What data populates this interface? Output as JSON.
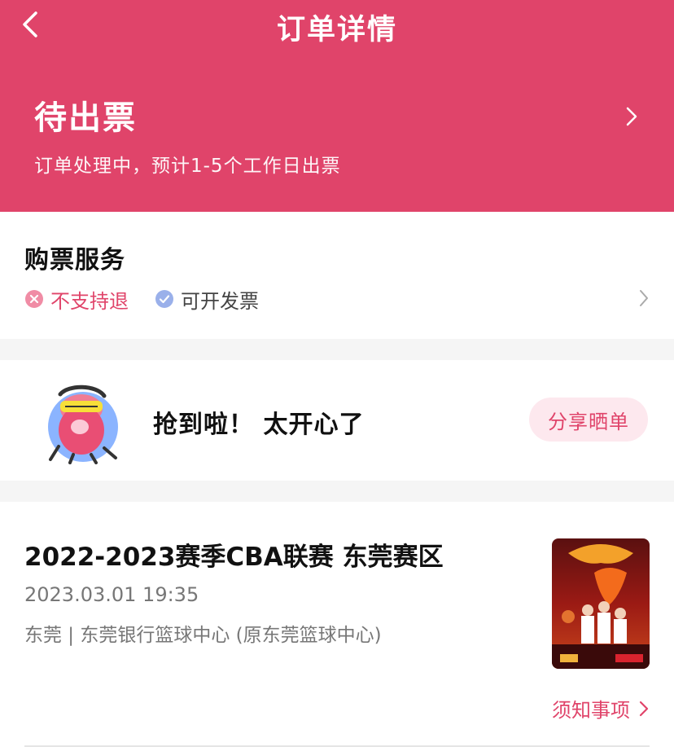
{
  "nav": {
    "title": "订单详情",
    "back_icon": "chevron-left-icon"
  },
  "status": {
    "title": "待出票",
    "description": "订单处理中，预计1-5个工作日出票"
  },
  "service": {
    "title": "购票服务",
    "tags": [
      {
        "label": "不支持退",
        "icon": "x-circle-icon",
        "color": "#e0446a"
      },
      {
        "label": "可开发票",
        "icon": "check-circle-icon",
        "color": "#9ab0ea"
      }
    ]
  },
  "share": {
    "text": "抢到啦！ 太开心了",
    "button": "分享晒单"
  },
  "event": {
    "title": "2022-2023赛季CBA联赛 东莞赛区",
    "datetime": "2023.03.01 19:35",
    "venue": "东莞 | 东莞银行篮球中心 (原东莞篮球中心)",
    "notice": "须知事项"
  },
  "colors": {
    "accent": "#e0446a",
    "background": "#f5f5f5",
    "card": "#ffffff"
  }
}
